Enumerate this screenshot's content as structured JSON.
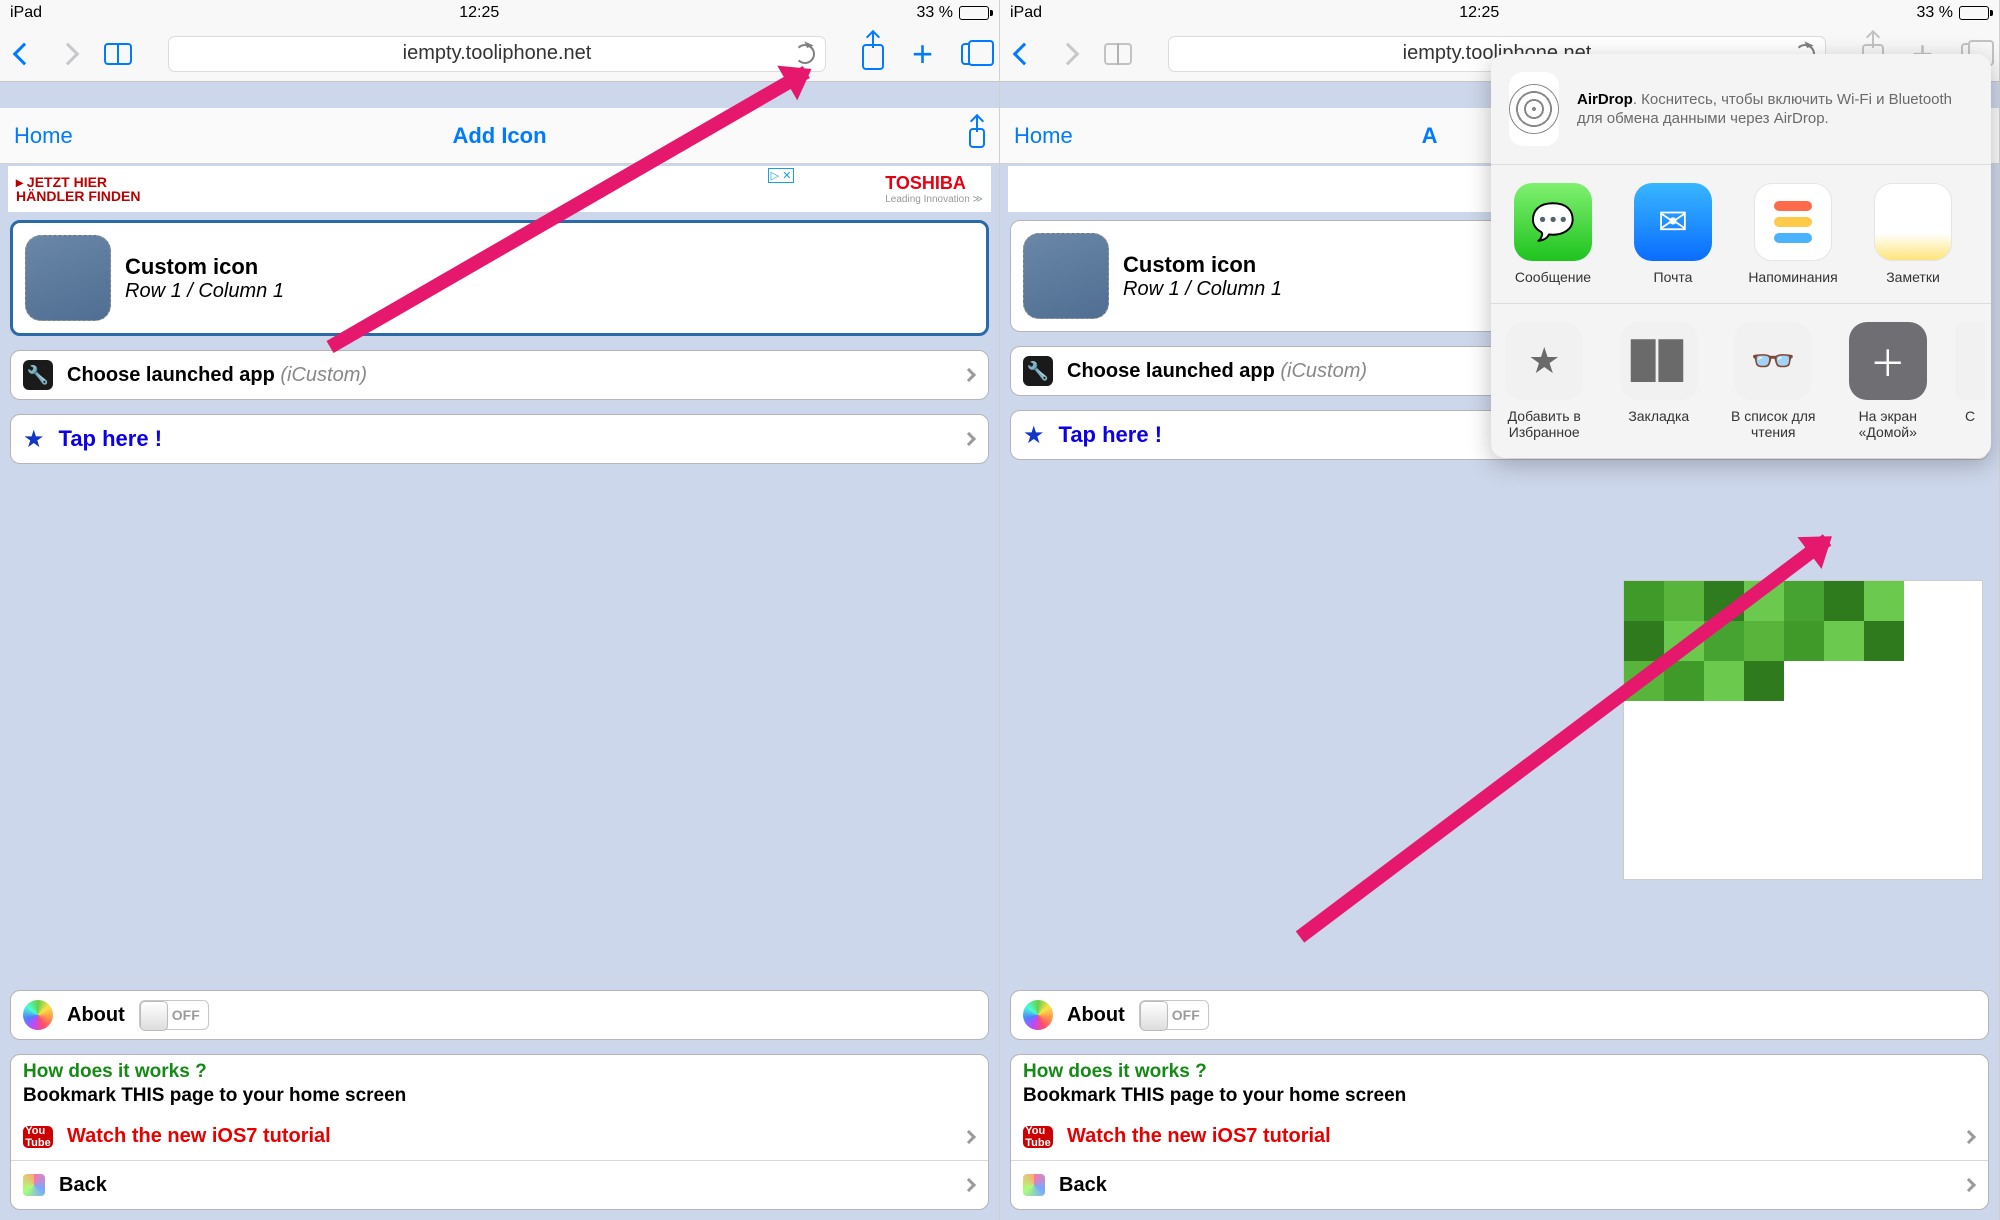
{
  "status": {
    "device": "iPad",
    "time": "12:25",
    "battery": "33 %"
  },
  "safari": {
    "url": "iempty.tooliphone.net"
  },
  "page": {
    "home": "Home",
    "title": "Add Icon",
    "ad_line1": "▸ JETZT HIER",
    "ad_line2": "HÄNDLER FINDEN",
    "toshiba": "TOSHIBA",
    "toshiba_sub": "Leading Innovation ≫",
    "custom_title": "Custom icon",
    "custom_sub": "Row 1 / Column 1",
    "choose_label": "Choose launched app",
    "choose_hint": "(iCustom)",
    "tap_here": "Tap here !",
    "about": "About",
    "toggle_off": "OFF",
    "how": "How does it works ?",
    "bookmark": "Bookmark THIS page to your home screen",
    "watch": "Watch the new iOS7 tutorial",
    "back": "Back"
  },
  "share": {
    "airdrop_title": "AirDrop",
    "airdrop_body": ". Коснитесь, чтобы включить Wi-Fi и Bluetooth для обмена данными через AirDrop.",
    "apps": [
      {
        "label": "Сообщение"
      },
      {
        "label": "Почта"
      },
      {
        "label": "Напоминания"
      },
      {
        "label": "Заметки"
      }
    ],
    "actions": [
      {
        "label": "Добавить в Избранное"
      },
      {
        "label": "Закладка"
      },
      {
        "label": "В список для чтения"
      },
      {
        "label": "На экран «Домой»"
      }
    ],
    "more": "С"
  }
}
